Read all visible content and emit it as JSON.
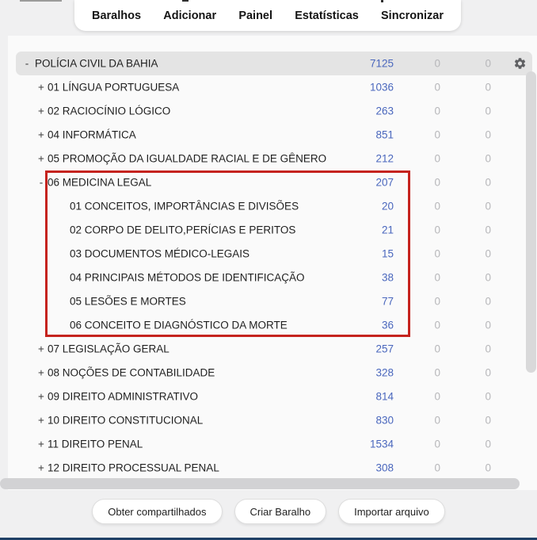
{
  "nav": {
    "items": [
      {
        "label": "Baralhos"
      },
      {
        "label": "Adicionar"
      },
      {
        "label": "Painel"
      },
      {
        "label": "Estatísticas"
      },
      {
        "label": "Sincronizar"
      }
    ]
  },
  "deck_table": {
    "rows": [
      {
        "level": 0,
        "toggle": "-",
        "name": "POLÍCIA CIVIL DA BAHIA",
        "counts": [
          "7125",
          "0",
          "0"
        ],
        "selected": true,
        "gear": true
      },
      {
        "level": 1,
        "toggle": "+",
        "name": "01 LÍNGUA PORTUGUESA",
        "counts": [
          "1036",
          "0",
          "0"
        ]
      },
      {
        "level": 1,
        "toggle": "+",
        "name": "02 RACIOCÍNIO LÓGICO",
        "counts": [
          "263",
          "0",
          "0"
        ]
      },
      {
        "level": 1,
        "toggle": "+",
        "name": "04 INFORMÁTICA",
        "counts": [
          "851",
          "0",
          "0"
        ]
      },
      {
        "level": 1,
        "toggle": "+",
        "name": "05 PROMOÇÃO DA IGUALDADE RACIAL E DE GÊNERO",
        "counts": [
          "212",
          "0",
          "0"
        ]
      },
      {
        "level": 1,
        "toggle": "-",
        "name": "06 MEDICINA LEGAL",
        "counts": [
          "207",
          "0",
          "0"
        ]
      },
      {
        "level": 2,
        "toggle": "",
        "name": "01 CONCEITOS, IMPORTÂNCIAS E DIVISÕES",
        "counts": [
          "20",
          "0",
          "0"
        ]
      },
      {
        "level": 2,
        "toggle": "",
        "name": "02 CORPO DE DELITO,PERÍCIAS E PERITOS",
        "counts": [
          "21",
          "0",
          "0"
        ]
      },
      {
        "level": 2,
        "toggle": "",
        "name": "03 DOCUMENTOS MÉDICO-LEGAIS",
        "counts": [
          "15",
          "0",
          "0"
        ]
      },
      {
        "level": 2,
        "toggle": "",
        "name": "04 PRINCIPAIS MÉTODOS DE IDENTIFICAÇÃO",
        "counts": [
          "38",
          "0",
          "0"
        ]
      },
      {
        "level": 2,
        "toggle": "",
        "name": "05 LESÕES E MORTES",
        "counts": [
          "77",
          "0",
          "0"
        ]
      },
      {
        "level": 2,
        "toggle": "",
        "name": "06 CONCEITO E DIAGNÓSTICO DA MORTE",
        "counts": [
          "36",
          "0",
          "0"
        ]
      },
      {
        "level": 1,
        "toggle": "+",
        "name": "07 LEGISLAÇÃO GERAL",
        "counts": [
          "257",
          "0",
          "0"
        ]
      },
      {
        "level": 1,
        "toggle": "+",
        "name": "08 NOÇÕES DE CONTABILIDADE",
        "counts": [
          "328",
          "0",
          "0"
        ]
      },
      {
        "level": 1,
        "toggle": "+",
        "name": "09 DIREITO ADMINISTRATIVO",
        "counts": [
          "814",
          "0",
          "0"
        ]
      },
      {
        "level": 1,
        "toggle": "+",
        "name": "10 DIREITO CONSTITUCIONAL",
        "counts": [
          "830",
          "0",
          "0"
        ]
      },
      {
        "level": 1,
        "toggle": "+",
        "name": "11 DIREITO PENAL",
        "counts": [
          "1534",
          "0",
          "0"
        ]
      },
      {
        "level": 1,
        "toggle": "+",
        "name": "12 DIREITO PROCESSUAL PENAL",
        "counts": [
          "308",
          "0",
          "0"
        ]
      }
    ],
    "annotation": {
      "shape": "red-rectangle",
      "rows_enclosed": "06 MEDICINA LEGAL and its six subdecks"
    }
  },
  "footer": {
    "buttons": [
      {
        "label": "Obter compartilhados"
      },
      {
        "label": "Criar Baralho"
      },
      {
        "label": "Importar arquivo"
      }
    ]
  },
  "icons": {
    "gear": "gear-icon"
  },
  "colors": {
    "due_count_blue": "#4a67bd",
    "zero_count_gray": "#b7b7ba",
    "annotation_red": "#c5231e",
    "selected_row_gray": "#e4e4e4",
    "taskbar_edge_blue": "#1f4066",
    "page_background": "#f0f0f1",
    "card_background": "#fafafa"
  }
}
